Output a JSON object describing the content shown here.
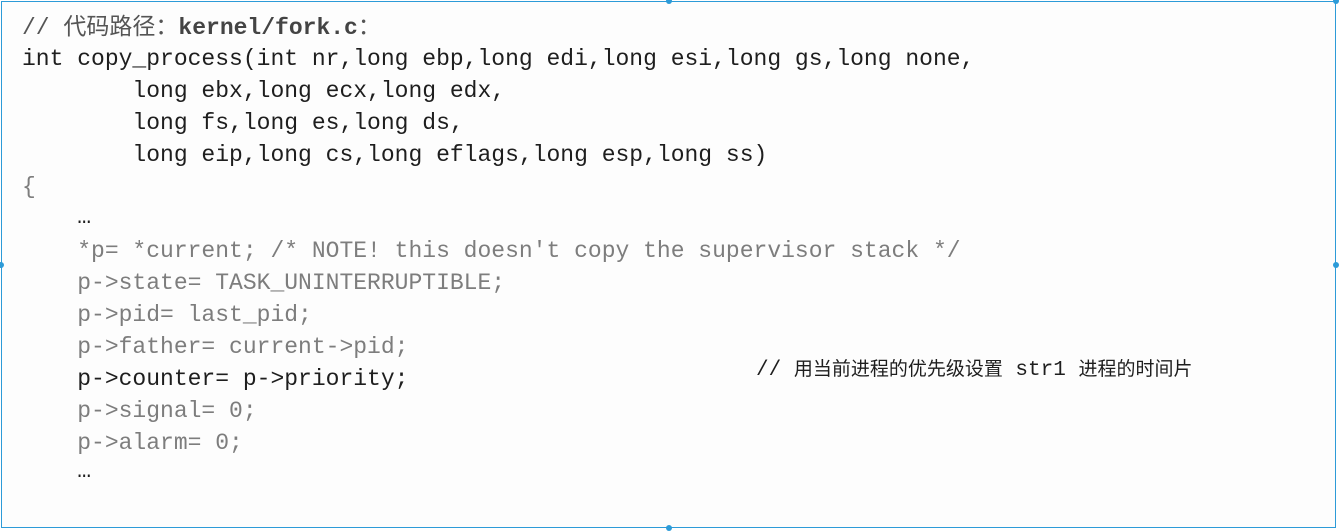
{
  "header_comment": {
    "prefix": "// ",
    "label": "代码路径：",
    "path": "kernel/fork.c",
    "suffix": "："
  },
  "lines": [
    "int copy_process(int nr,long ebp,long edi,long esi,long gs,long none,",
    "        long ebx,long ecx,long edx,",
    "        long fs,long es,long ds,",
    "        long eip,long cs,long eflags,long esp,long ss)",
    "{",
    "    …",
    "    *p= *current; /* NOTE! this doesn't copy the supervisor stack */",
    "    p->state= TASK_UNINTERRUPTIBLE;",
    "    p->pid= last_pid;",
    "    p->father= current->pid;",
    "    p->counter= p->priority;",
    "    p->signal= 0;",
    "    p->alarm= 0;",
    "    …"
  ],
  "side_comment": {
    "slashes": "// ",
    "part1": "用当前进程的优先级设置",
    "code": " str1 ",
    "part2": "进程的时间片"
  },
  "colors": {
    "frame_border": "#2d9bd8",
    "text_dark": "#1e1e1e",
    "text_light": "#7d7d7d"
  }
}
